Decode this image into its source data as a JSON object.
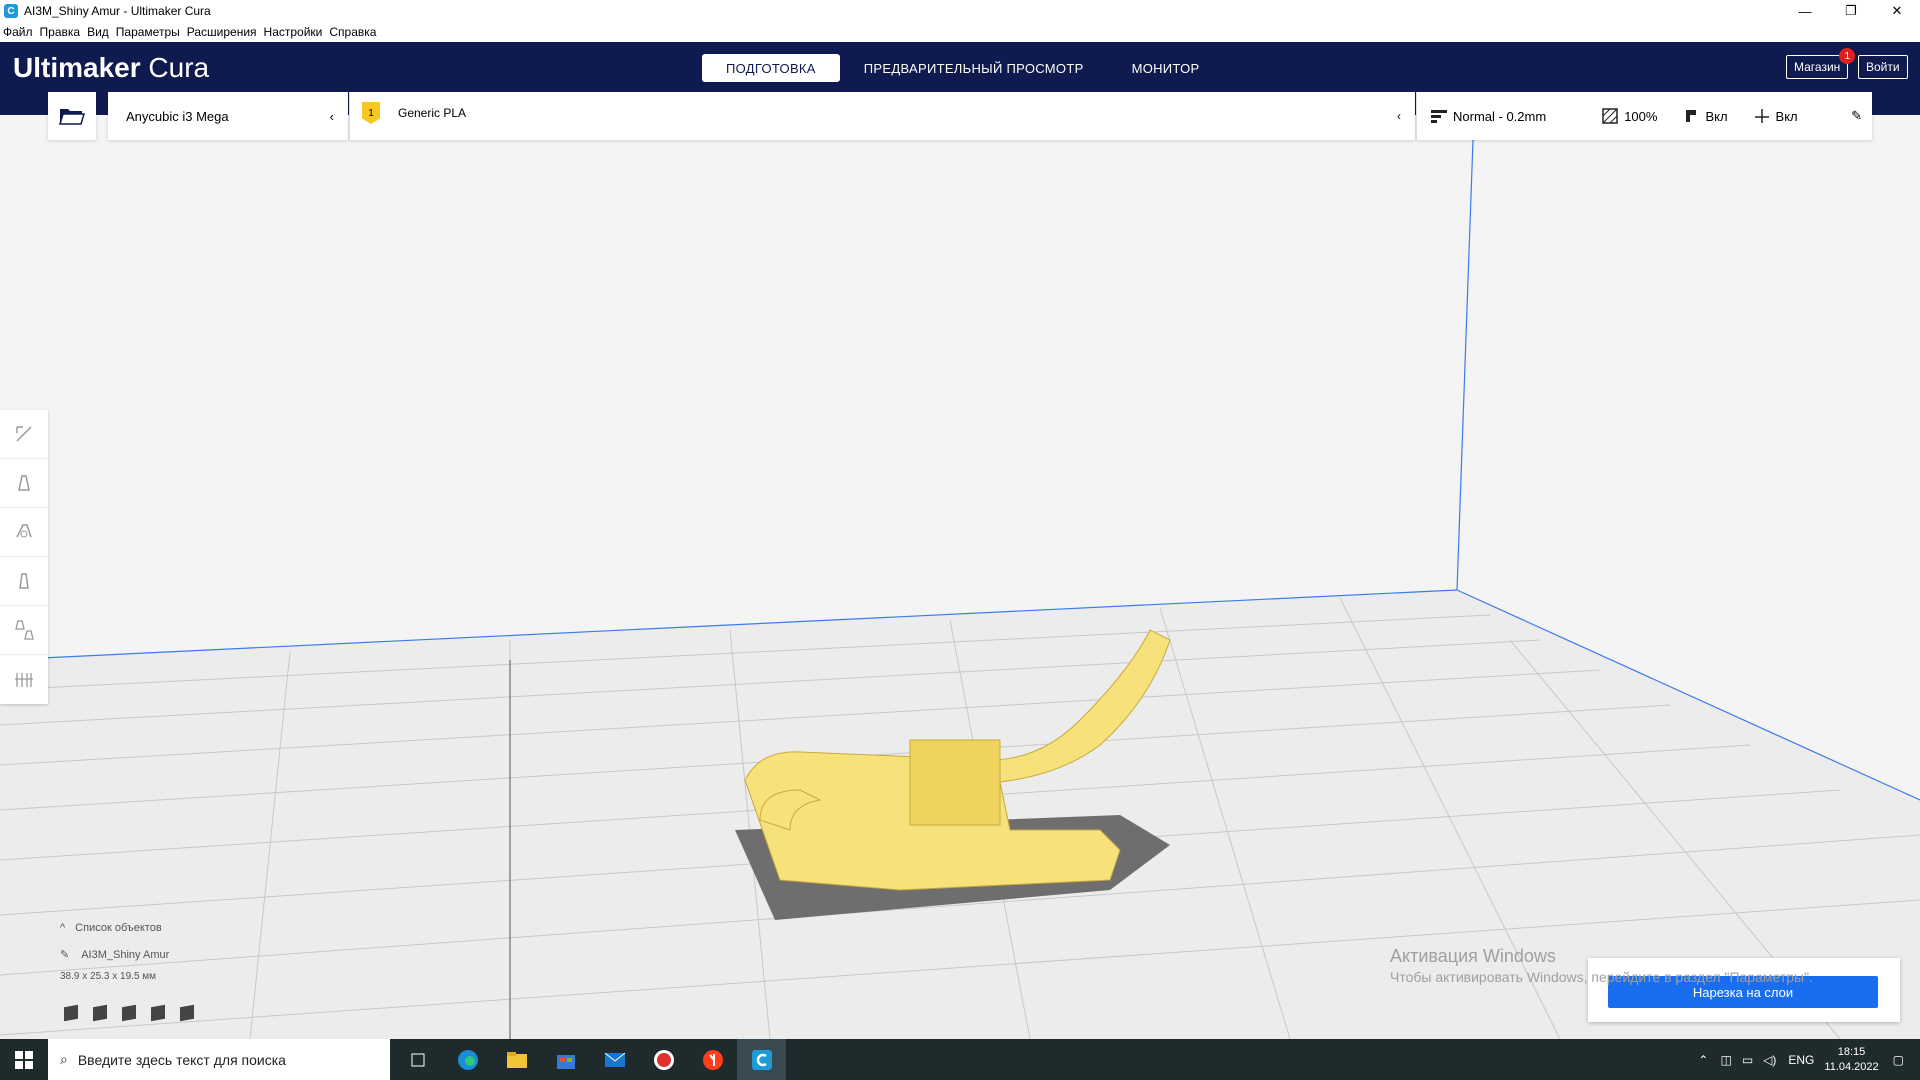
{
  "window": {
    "title": "AI3M_Shiny Amur - Ultimaker Cura",
    "app_icon": "C",
    "min": "—",
    "restore": "❐",
    "close": "✕"
  },
  "menu": [
    "Файл",
    "Правка",
    "Вид",
    "Параметры",
    "Расширения",
    "Настройки",
    "Справка"
  ],
  "header": {
    "logo_bold": "Ultimaker",
    "logo_light": " Cura",
    "stages": [
      "ПОДГОТОВКА",
      "ПРЕДВАРИТЕЛЬНЫЙ ПРОСМОТР",
      "МОНИТОР"
    ],
    "marketplace": "Магазин",
    "marketplace_badge": "1",
    "signin": "Войти"
  },
  "toolbar": {
    "printer": "Anycubic i3 Mega",
    "extruder_number": "1",
    "material": "Generic PLA",
    "profile": "Normal - 0.2mm",
    "infill": "100%",
    "support": "Вкл",
    "adhesion": "Вкл"
  },
  "objects": {
    "header": "Список объектов",
    "name": "AI3M_Shiny Amur",
    "dimensions": "38.9 x 25.3 x 19.5 мм"
  },
  "slice_button": "Нарезка на слои",
  "watermark": {
    "title": "Активация Windows",
    "text": "Чтобы активировать Windows, перейдите в раздел \"Параметры\"."
  },
  "taskbar": {
    "search_placeholder": "Введите здесь текст для поиска",
    "language": "ENG",
    "time": "18:15",
    "date": "11.04.2022"
  },
  "colors": {
    "header": "#0f1a4e",
    "model": "#f7e17a",
    "slice_button": "#196ef0"
  }
}
